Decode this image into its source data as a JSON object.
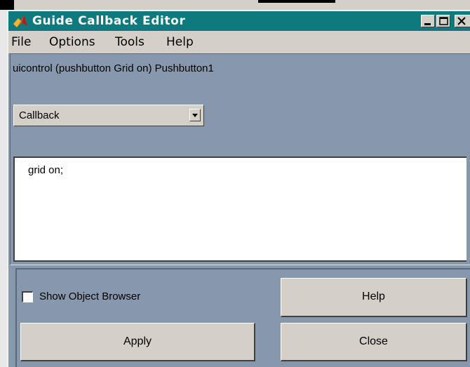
{
  "window": {
    "title": "Guide Callback Editor"
  },
  "menu": {
    "items": [
      "File",
      "Options",
      "Tools",
      "Help"
    ]
  },
  "object_label": "uicontrol (pushbutton Grid on) Pushbutton1",
  "callback_select": {
    "value": "Callback"
  },
  "editor": {
    "code": "grid on;"
  },
  "options": {
    "show_object_browser_label": "Show Object Browser",
    "show_object_browser_checked": false
  },
  "buttons": {
    "help": "Help",
    "apply": "Apply",
    "close": "Close"
  },
  "colors": {
    "titlebar": "#0e7a7e",
    "panel": "#8898ac",
    "button_face": "#d4d0c8"
  }
}
